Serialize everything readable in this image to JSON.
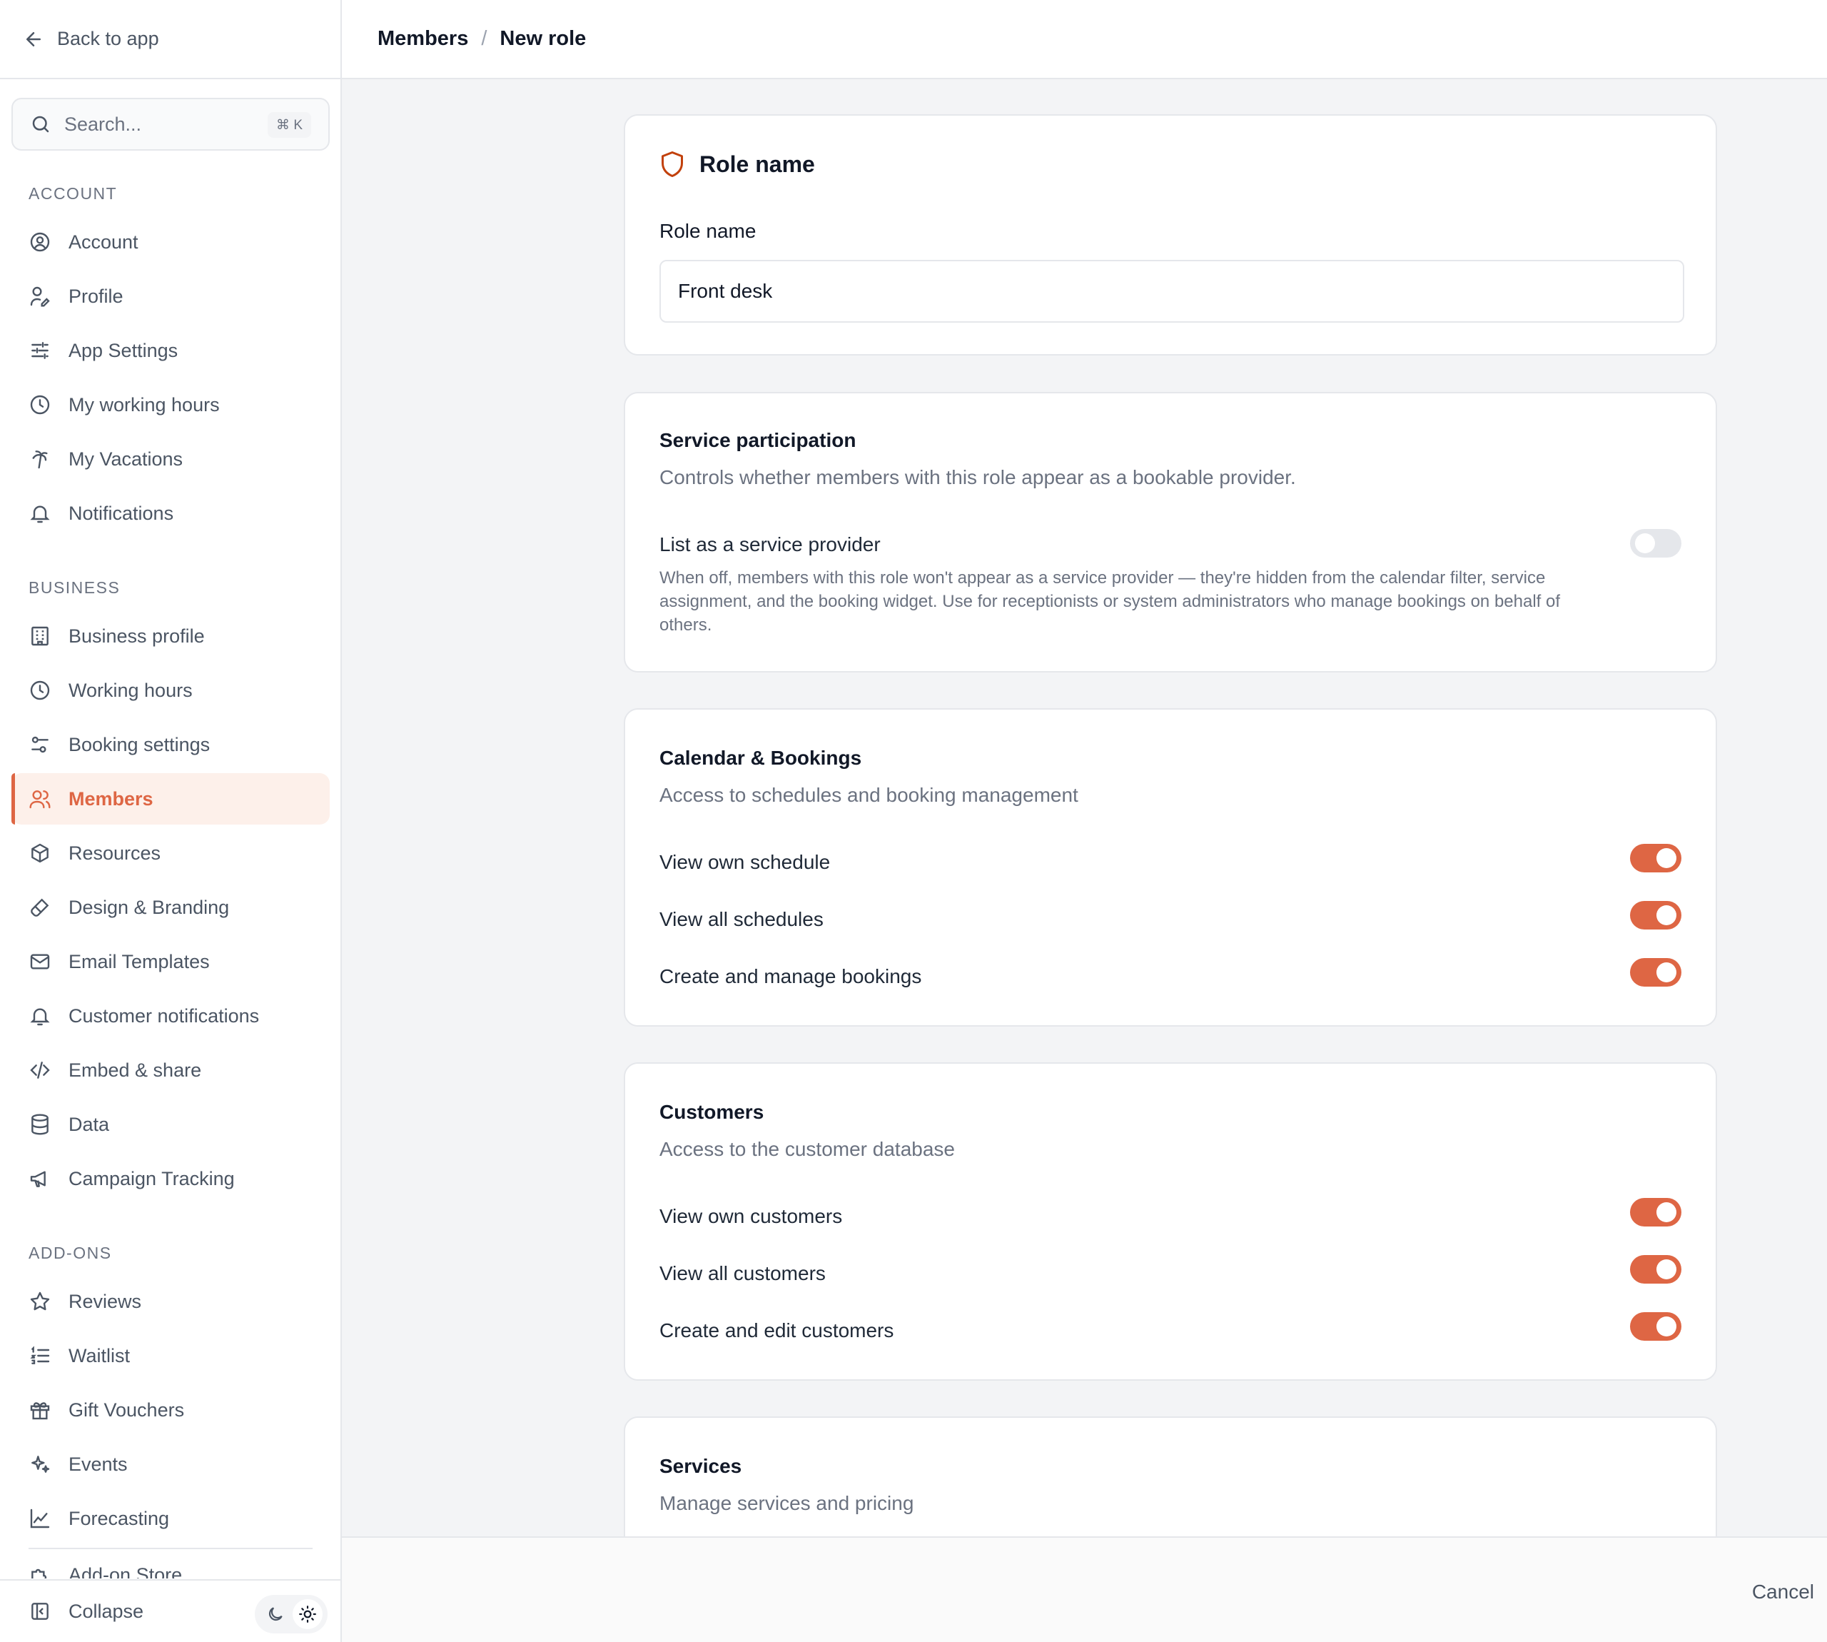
{
  "nav": {
    "back_label": "Back to app",
    "search_placeholder": "Search...",
    "search_shortcut": "⌘ K",
    "sections": {
      "account": "ACCOUNT",
      "business": "BUSINESS",
      "addons": "ADD-ONS"
    },
    "items": {
      "account": "Account",
      "profile": "Profile",
      "app_settings": "App Settings",
      "my_working_hours": "My working hours",
      "my_vacations": "My Vacations",
      "notifications": "Notifications",
      "business_profile": "Business profile",
      "working_hours": "Working hours",
      "booking_settings": "Booking settings",
      "members": "Members",
      "resources": "Resources",
      "design_branding": "Design & Branding",
      "email_templates": "Email Templates",
      "customer_notifications": "Customer notifications",
      "embed_share": "Embed & share",
      "data": "Data",
      "campaign_tracking": "Campaign Tracking",
      "reviews": "Reviews",
      "waitlist": "Waitlist",
      "gift_vouchers": "Gift Vouchers",
      "events": "Events",
      "forecasting": "Forecasting",
      "addon_store": "Add-on Store"
    },
    "collapse_label": "Collapse",
    "active_item": "Members"
  },
  "breadcrumb": {
    "parent": "Members",
    "separator": "/",
    "current": "New role"
  },
  "role_card": {
    "header": "Role name",
    "field_label": "Role name",
    "field_value": "Front desk"
  },
  "service_participation": {
    "title": "Service participation",
    "description": "Controls whether members with this role appear as a bookable provider.",
    "option_label": "List as a service provider",
    "option_enabled": false,
    "help": "When off, members with this role won't appear as a service provider — they're hidden from the calendar filter, service assignment, and the booking widget. Use for receptionists or system administrators who manage bookings on behalf of others."
  },
  "calendar_bookings": {
    "title": "Calendar & Bookings",
    "description": "Access to schedules and booking management",
    "permissions": [
      {
        "label": "View own schedule",
        "enabled": true
      },
      {
        "label": "View all schedules",
        "enabled": true
      },
      {
        "label": "Create and manage bookings",
        "enabled": true
      }
    ]
  },
  "customers": {
    "title": "Customers",
    "description": "Access to the customer database",
    "permissions": [
      {
        "label": "View own customers",
        "enabled": true
      },
      {
        "label": "View all customers",
        "enabled": true
      },
      {
        "label": "Create and edit customers",
        "enabled": true
      }
    ]
  },
  "services": {
    "title": "Services",
    "description": "Manage services and pricing"
  },
  "footer": {
    "cancel_label": "Cancel"
  },
  "colors": {
    "accent": "#de6644",
    "active_bg": "#fdf0ea"
  }
}
